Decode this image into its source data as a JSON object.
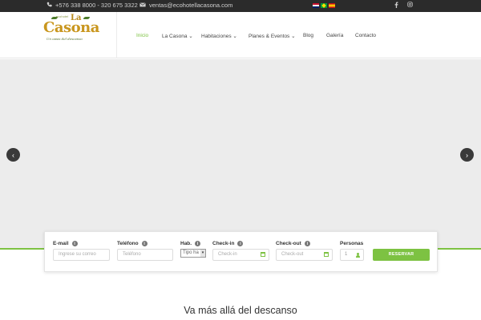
{
  "topbar": {
    "phone_icon": "phone-icon",
    "phone": "+576 338 8000 - 320 675 3322",
    "email_icon": "envelope-icon",
    "email": "ventas@ecohotellacasona.com",
    "languages": [
      "en-flag-icon",
      "pt-flag-icon",
      "es-flag-icon"
    ],
    "social": [
      "facebook-icon",
      "instagram-icon"
    ]
  },
  "logo": {
    "small": "ecohotel",
    "la": "La",
    "name": "Casona",
    "tagline": "Un oasis del descanso"
  },
  "nav": {
    "items": [
      {
        "label": "Inicio",
        "active": true
      },
      {
        "label": "La Casona",
        "dropdown": true
      },
      {
        "label": "Habitaciones",
        "dropdown": true
      },
      {
        "label": "Planes & Eventos",
        "dropdown": true
      },
      {
        "label": "Blog"
      },
      {
        "label": "Galería"
      },
      {
        "label": "Contacto"
      }
    ],
    "caret": "⌄"
  },
  "slider": {
    "prev_icon": "chevron-left-icon",
    "next_icon": "chevron-right-icon",
    "prev": "‹",
    "next": "›"
  },
  "booking": {
    "email_label": "E-mail",
    "email_placeholder": "Ingrese su correo",
    "phone_label": "Teléfono",
    "phone_placeholder": "Teléfono",
    "room_label": "Hab.",
    "room_value": "Tipo ha",
    "checkin_label": "Check-in",
    "checkin_placeholder": "Check-in",
    "checkout_label": "Check-out",
    "checkout_placeholder": "Check-out",
    "persons_label": "Personas",
    "persons_value": "1",
    "button": "RESERVAR",
    "info_glyph": "i"
  },
  "headline": "Va más allá del descanso",
  "colors": {
    "accent": "#7dc242",
    "topbar": "#2b2b2b",
    "slider_bg": "#ececec",
    "logo_gold": "#c9961e"
  }
}
